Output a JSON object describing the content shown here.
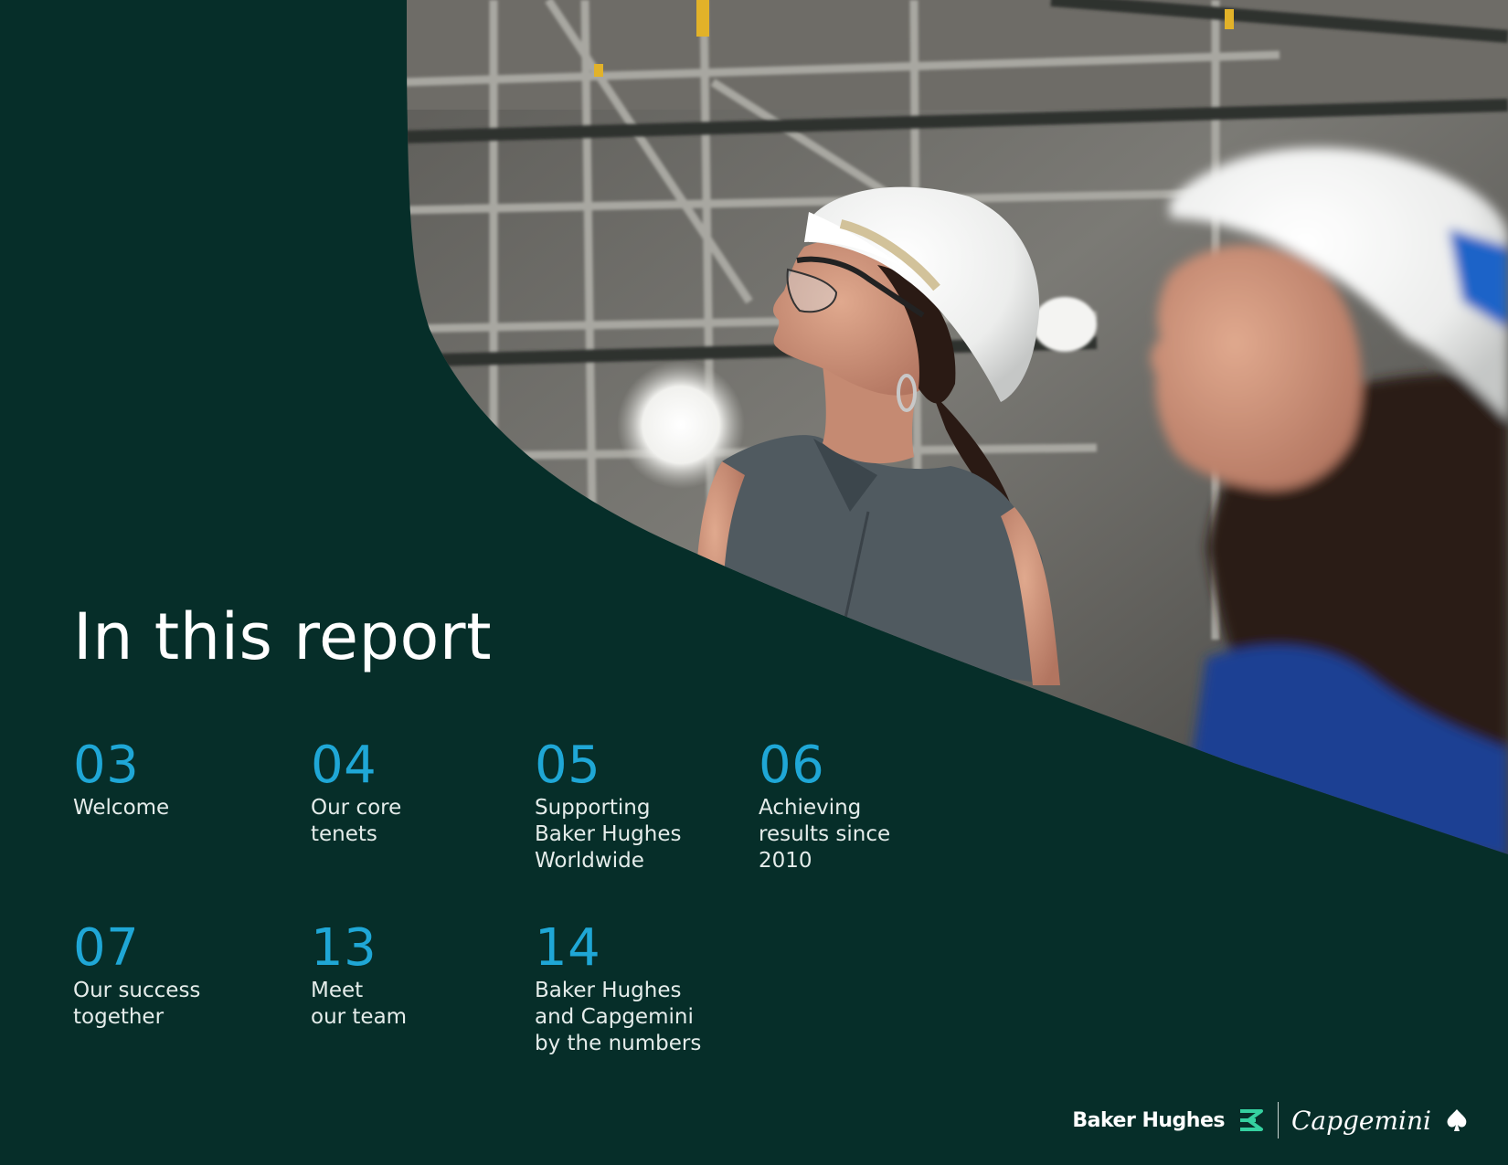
{
  "report": {
    "title": "In this report"
  },
  "toc": [
    {
      "number": "03",
      "label": "Welcome"
    },
    {
      "number": "04",
      "label": "Our core\ntenets"
    },
    {
      "number": "05",
      "label": "Supporting\nBaker Hughes\nWorldwide"
    },
    {
      "number": "06",
      "label": "Achieving\nresults since\n2010"
    },
    {
      "number": "07",
      "label": "Our success\ntogether"
    },
    {
      "number": "13",
      "label": "Meet\nour team"
    },
    {
      "number": "14",
      "label": "Baker Hughes\nand Capgemini\nby the numbers"
    }
  ],
  "footer": {
    "brand_left": "Baker Hughes",
    "brand_right": "Capgemini"
  },
  "colors": {
    "background": "#062e29",
    "accent_number": "#1fa7d6",
    "bh_logo_green": "#35d0a0",
    "helmet_blue": "#1e63c8"
  },
  "icons": {
    "bh_logo": "double-chevron-icon",
    "capgemini_logo": "spade-icon"
  }
}
